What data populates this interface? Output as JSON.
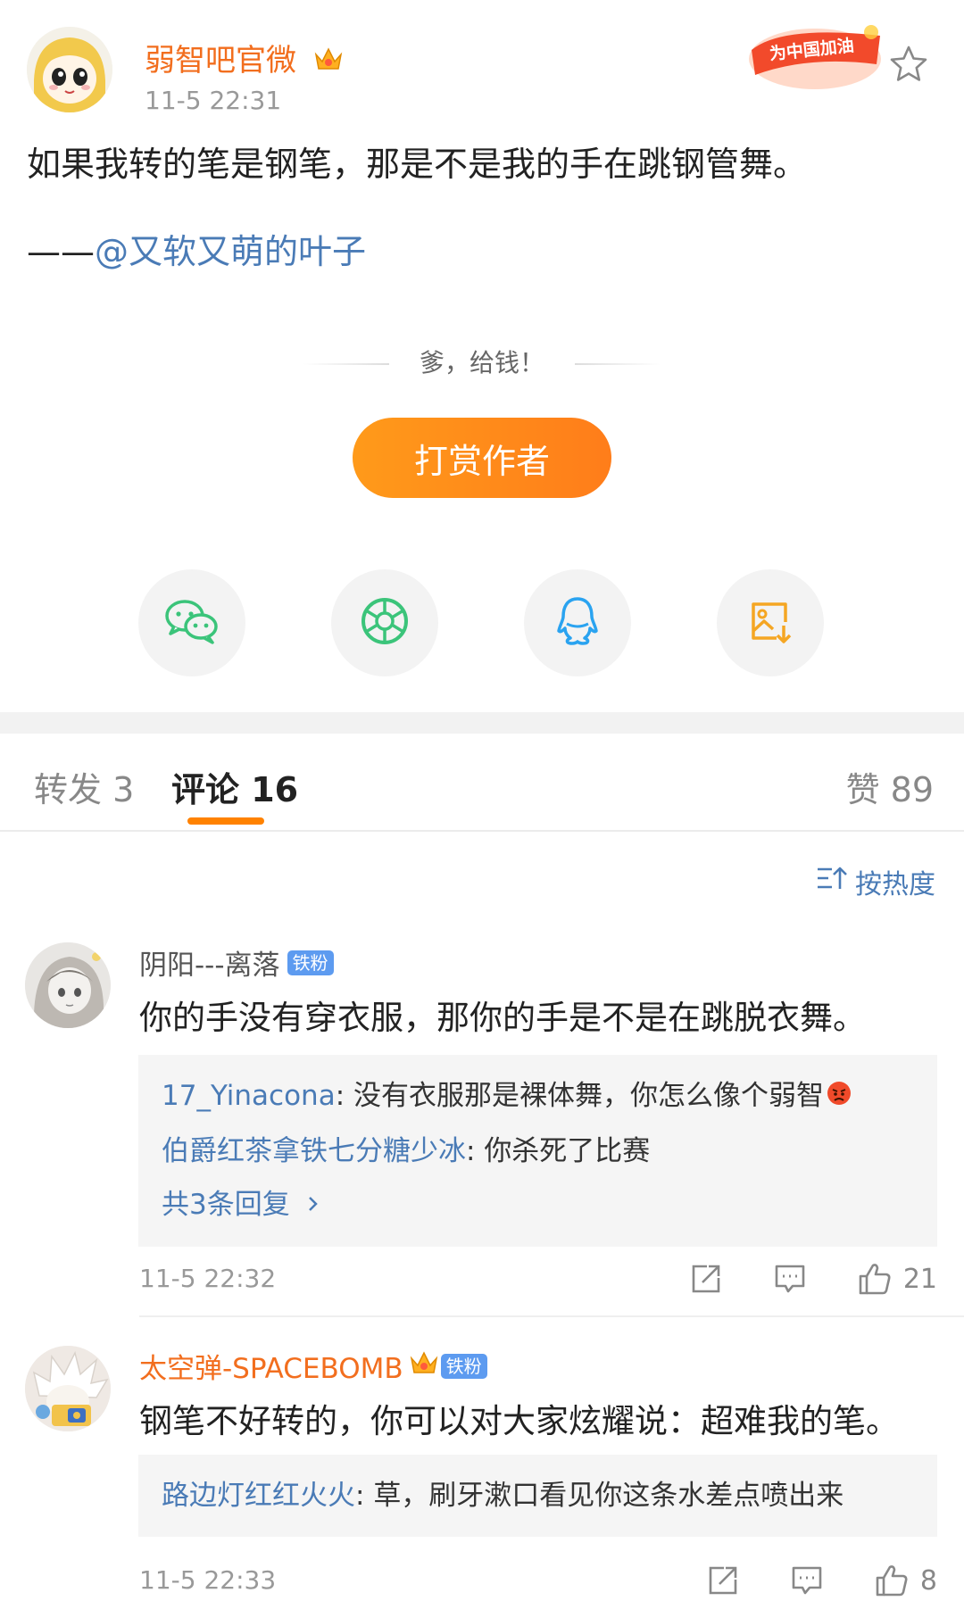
{
  "post": {
    "author": "弱智吧官微",
    "time": "11-5 22:31",
    "text": "如果我转的笔是钢笔，那是不是我的手在跳钢管舞。",
    "quote_prefix": "——",
    "quote_mention": "@又软又萌的叶子",
    "badge_text": "为中国加油"
  },
  "reward": {
    "prompt": "爹，给钱！",
    "button_label": "打赏作者"
  },
  "share": {
    "items": [
      "wechat-icon",
      "moments-icon",
      "qq-icon",
      "save-image-icon"
    ]
  },
  "tabs": {
    "repost": "转发 3",
    "comments": "评论 16",
    "likes": "赞 89"
  },
  "sort": {
    "label": "按热度"
  },
  "comments": [
    {
      "name": "阴阳---离落",
      "badge": "铁粉",
      "text": "你的手没有穿衣服，那你的手是不是在跳脱衣舞。",
      "replies": [
        {
          "name": "17_Yinacona",
          "sep": ": ",
          "text": "没有衣服那是裸体舞，你怎么像个弱智"
        },
        {
          "name": "伯爵红茶拿铁七分糖少冰",
          "sep": ": ",
          "text": "你杀死了比赛"
        }
      ],
      "more_replies": "共3条回复",
      "time": "11-5 22:32",
      "likes": "21"
    },
    {
      "name": "太空弹-SPACEBOMB",
      "badge": "铁粉",
      "text": "钢笔不好转的，你可以对大家炫耀说：超难我的笔。",
      "replies": [
        {
          "name": "路边灯红红火火",
          "sep": ": ",
          "text": "草，刷牙漱口看见你这条水差点喷出来"
        }
      ],
      "time": "11-5 22:33",
      "likes": "8"
    }
  ],
  "colors": {
    "accent_orange": "#ff8200",
    "link_blue": "#4a7bb6",
    "name_orange": "#f26e1e"
  }
}
